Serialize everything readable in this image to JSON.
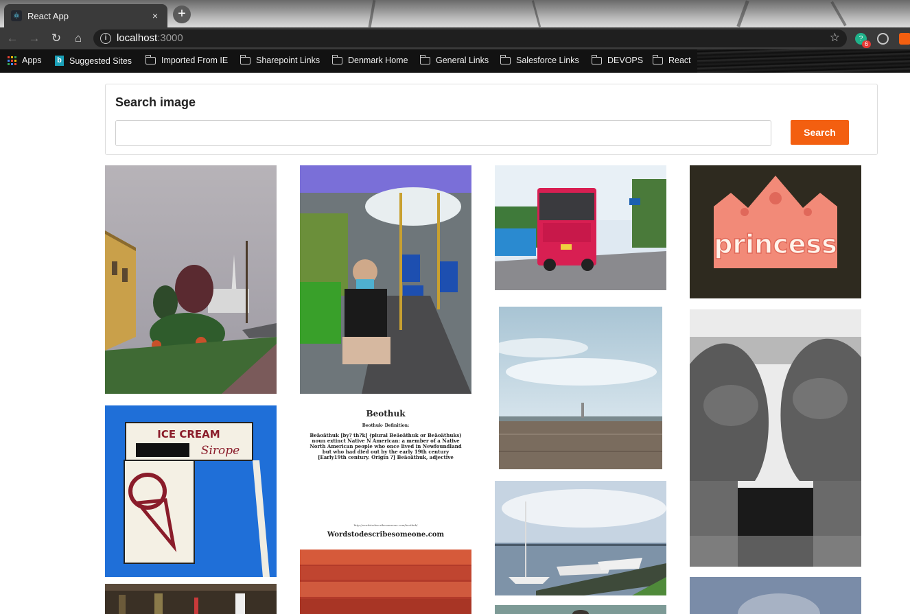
{
  "browser": {
    "tab_title": "React App",
    "tab_close": "×",
    "new_tab": "+",
    "url_host": "localhost",
    "url_port": ":3000",
    "nav": {
      "back": "←",
      "forward": "→",
      "reload": "↻",
      "home": "⌂"
    },
    "star": "☆",
    "extension_badge": "6"
  },
  "bookmarks": [
    {
      "label": "Apps",
      "icon": "apps-grid-icon"
    },
    {
      "label": "Suggested Sites",
      "icon": "bing-icon"
    },
    {
      "label": "Imported From IE",
      "icon": "folder-icon"
    },
    {
      "label": "Sharepoint Links",
      "icon": "folder-icon"
    },
    {
      "label": "Denmark Home",
      "icon": "folder-icon"
    },
    {
      "label": "General Links",
      "icon": "folder-icon"
    },
    {
      "label": "Salesforce Links",
      "icon": "folder-icon"
    },
    {
      "label": "DEVOPS",
      "icon": "folder-icon"
    },
    {
      "label": "React",
      "icon": "folder-icon"
    }
  ],
  "search": {
    "title": "Search image",
    "value": "",
    "button_label": "Search"
  },
  "gallery": {
    "ice_cream_sign_top": "ICE CREAM",
    "ice_cream_sign_script": "Sirope",
    "princess_text": "princess",
    "beothuk": {
      "heading": "Beothuk",
      "subheading": "Beothuk- Definition:",
      "body": "Beäoäthuk [by? th?k] (plural Beäoäthuk or Beäoäthuks) noun extinct Native N American: a member of a Native North American people who once lived in Newfoundland but who had died out by the early 19th century [Early19th century. Origin ?] Beäoäthuk, adjective",
      "url": "http://wordstodescribesomeone.com/beothuk/",
      "site": "Wordstodescribesomeone.com"
    }
  },
  "colors": {
    "accent": "#f35f10",
    "tab_bg": "#3a3a3a",
    "bookmark_bg": "#121212"
  }
}
